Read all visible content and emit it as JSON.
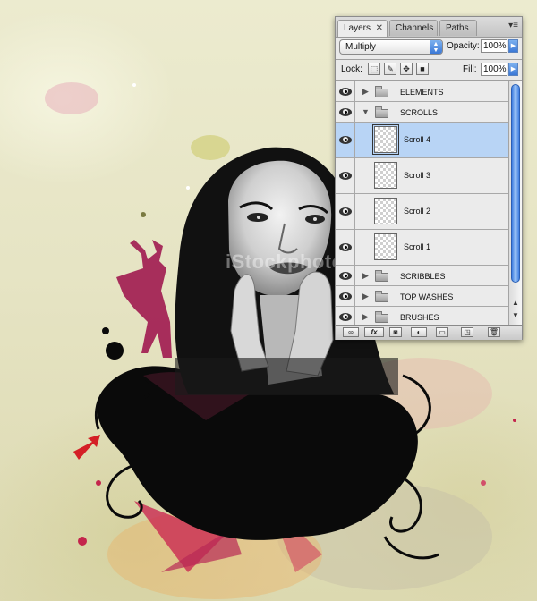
{
  "canvas": {
    "watermark": "iStockphoto",
    "arrow_color": "#d41f26"
  },
  "panel": {
    "tabs": [
      {
        "label": "Layers",
        "active": true,
        "close": "✕"
      },
      {
        "label": "Channels",
        "active": false
      },
      {
        "label": "Paths",
        "active": false
      }
    ],
    "menu_icon": "▾≡",
    "blend_mode": "Multiply",
    "opacity_label": "Opacity:",
    "opacity_value": "100%",
    "lock_label": "Lock:",
    "fill_label": "Fill:",
    "fill_value": "100%",
    "lock_icons": [
      "lock-transparent-icon",
      "lock-image-brush-icon",
      "lock-position-move-icon",
      "lock-all-padlock-icon"
    ],
    "layers": [
      {
        "name": "ELEMENTS",
        "type": "group",
        "expanded": false
      },
      {
        "name": "SCROLLS",
        "type": "group",
        "expanded": true
      },
      {
        "name": "Scroll 4",
        "type": "layer",
        "selected": true
      },
      {
        "name": "Scroll 3",
        "type": "layer"
      },
      {
        "name": "Scroll 2",
        "type": "layer"
      },
      {
        "name": "Scroll 1",
        "type": "layer"
      },
      {
        "name": "SCRIBBLES",
        "type": "group",
        "expanded": false
      },
      {
        "name": "TOP WASHES",
        "type": "group",
        "expanded": false
      },
      {
        "name": "BRUSHES",
        "type": "group",
        "expanded": false
      }
    ],
    "bottom_icons": [
      "link-icon",
      "fx-icon",
      "mask-icon",
      "adjustment-icon",
      "folder-icon",
      "new-layer-icon",
      "trash-icon"
    ],
    "fx_label": "fx"
  }
}
